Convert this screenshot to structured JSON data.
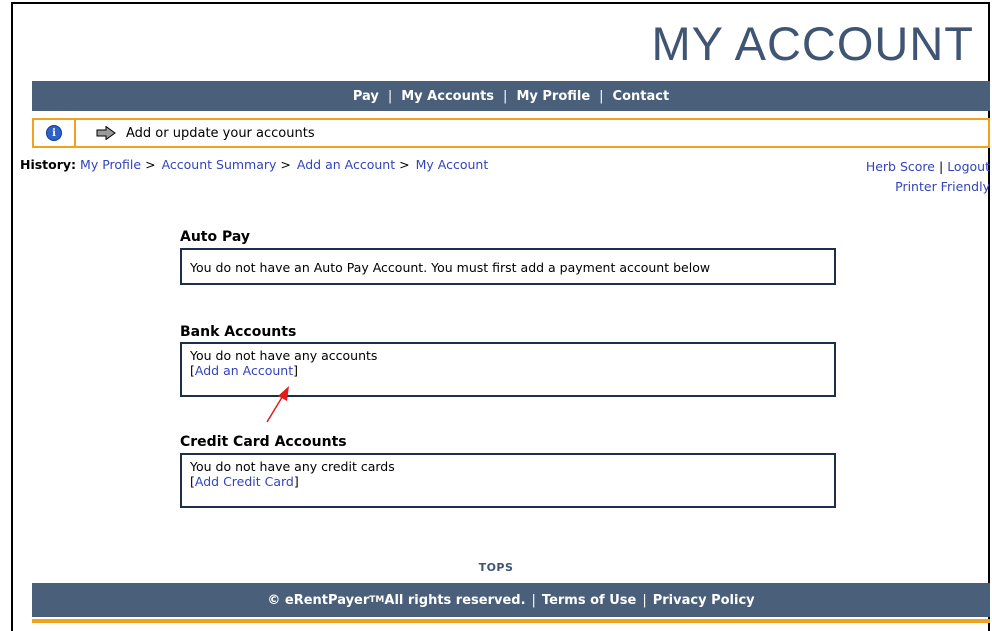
{
  "header": {
    "title": "MY ACCOUNT"
  },
  "topnav": {
    "items": [
      "Pay",
      "My Accounts",
      "My Profile",
      "Contact"
    ]
  },
  "infobar": {
    "icon": "info-icon",
    "message": "Add or update your accounts"
  },
  "history": {
    "label": "History:",
    "crumbs": [
      "My Profile",
      "Account Summary",
      "Add an Account",
      "My Account"
    ]
  },
  "user": {
    "name": "Herb Score",
    "logout": "Logout",
    "printer": "Printer Friendly"
  },
  "autopay": {
    "title": "Auto Pay",
    "text": "You do not have an Auto Pay Account. You must first add a payment account below"
  },
  "bank": {
    "title": "Bank Accounts",
    "text": "You do not have any accounts",
    "link": "Add an Account"
  },
  "credit": {
    "title": "Credit Card Accounts",
    "text": "You do not have any credit cards",
    "link": "Add Credit Card"
  },
  "tops": "TOPS",
  "footer": {
    "copyright": "© eRentPayer",
    "tm": "TM",
    "rights": " All rights reserved.",
    "terms": "Terms of Use",
    "privacy": "Privacy Policy"
  },
  "colors": {
    "brand": "#4a5f7a",
    "accent": "#f2a11f",
    "title": "#3f5573",
    "link": "#3344bb"
  }
}
